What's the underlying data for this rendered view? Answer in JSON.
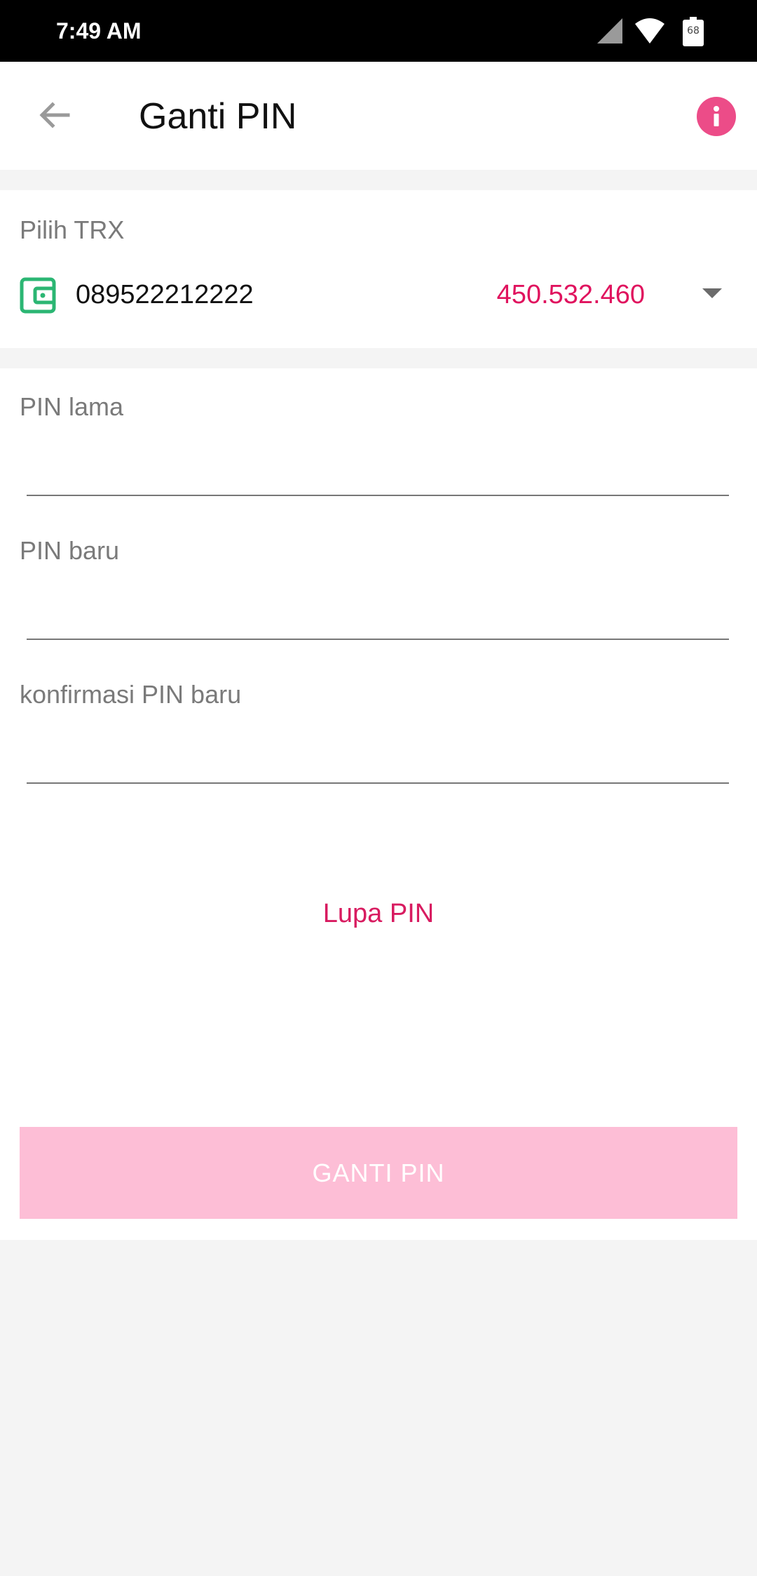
{
  "status_bar": {
    "time": "7:49 AM",
    "battery_level": "68",
    "icons": [
      "signal-icon",
      "wifi-icon",
      "battery-icon"
    ]
  },
  "app_bar": {
    "title": "Ganti PIN",
    "back_icon": "arrow-left-icon",
    "info_icon": "info-icon"
  },
  "trx": {
    "label": "Pilih TRX",
    "account_number": "089522212222",
    "balance": "450.532.460",
    "wallet_icon": "wallet-icon",
    "dropdown_icon": "caret-down-icon"
  },
  "form": {
    "old_pin_label": "PIN lama",
    "old_pin_value": "",
    "new_pin_label": "PIN baru",
    "new_pin_value": "",
    "confirm_pin_label": "konfirmasi PIN baru",
    "confirm_pin_value": "",
    "forgot_link": "Lupa PIN",
    "submit_label": "GANTI PIN"
  },
  "colors": {
    "accent": "#e0135e",
    "info_badge": "#ec4c88",
    "button_disabled": "#fdbed6",
    "wallet_icon": "#2bb673",
    "background": "#f4f4f4"
  }
}
